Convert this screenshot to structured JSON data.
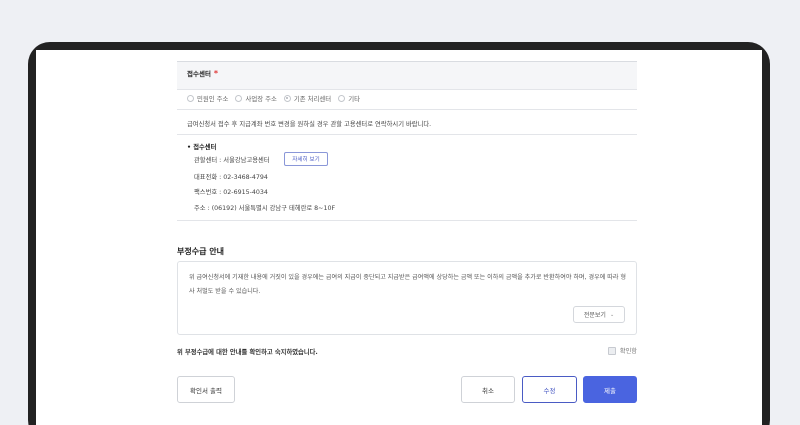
{
  "reception": {
    "section_title": "접수센터",
    "required_mark": "*",
    "options": [
      {
        "label": "민원인 주소",
        "checked": false
      },
      {
        "label": "사업장 주소",
        "checked": false
      },
      {
        "label": "기존 처리센터",
        "checked": true
      },
      {
        "label": "기타",
        "checked": false
      }
    ],
    "notice": "급여신청서 접수 후 지급계좌 번호 변경을 원하실 경우 관할 고용센터로 연락하시기 바랍니다.",
    "center_title": "• 접수센터",
    "center_name": "관할센터 : 서울강남고용센터",
    "detail_button": "자세히 보기",
    "phone": "대표전화 : 02-3468-4794",
    "fax": "팩스번호 : 02-6915-4034",
    "address": "주소 : (06192) 서울특별시 강남구 테헤란로 8~10F"
  },
  "fraud": {
    "title": "부정수급 안내",
    "text": "위 급여신청서에 기재한 내용에 거짓이 있을 경우에는 급여의 지급이 중단되고 지급받은 급여액에 상당하는 금액 또는 이하의 금액을 추가로 반환하여야 하며, 경우에 따라 형사 처벌도 받을 수 있습니다.",
    "full_text_button": "전문보기",
    "agree_text": "위 부정수급에 대한 안내를 확인하고 숙지하였습니다.",
    "confirm_label": "확인함"
  },
  "actions": {
    "print": "확인서 출력",
    "cancel": "취소",
    "edit": "수정",
    "submit": "제출"
  },
  "colors": {
    "primary": "#4a64e0",
    "required": "#e03a3a"
  }
}
